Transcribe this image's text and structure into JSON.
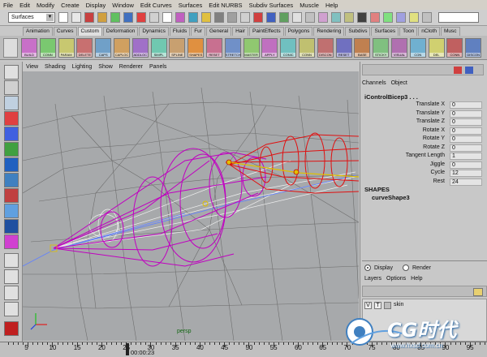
{
  "menubar": [
    "File",
    "Edit",
    "Modify",
    "Create",
    "Display",
    "Window",
    "Edit Curves",
    "Surfaces",
    "Edit NURBS",
    "Subdiv Surfaces",
    "Muscle",
    "Help"
  ],
  "mode_select": "Surfaces",
  "shelf_tabs": [
    "Animation",
    "Curves",
    "Custom",
    "Deformation",
    "Dynamics",
    "Fluids",
    "Fur",
    "General",
    "Hair",
    "PaintEffects",
    "Polygons",
    "Rendering",
    "Subdivs",
    "Surfaces",
    "Toon",
    "nCloth",
    "Musc"
  ],
  "active_shelf_tab": "Custom",
  "shelf_buttons": [
    {
      "label": "BUILD",
      "color": "#c870c8"
    },
    {
      "label": "CONN",
      "color": "#7ac870"
    },
    {
      "label": "PARAM",
      "color": "#c8c870"
    },
    {
      "label": "DELETE",
      "color": "#c87070"
    },
    {
      "label": "CAPS",
      "color": "#70a0c8"
    },
    {
      "label": "CAPLOC",
      "color": "#d0a060"
    },
    {
      "label": "ADDLOC",
      "color": "#a070c8"
    },
    {
      "label": "SIMPL",
      "color": "#70c8b0"
    },
    {
      "label": "SPLINE",
      "color": "#c8a070"
    },
    {
      "label": "SHAPES",
      "color": "#e09040"
    },
    {
      "label": "RESET",
      "color": "#c87090"
    },
    {
      "label": "STRETCH",
      "color": "#7090c8"
    },
    {
      "label": "MASTER",
      "color": "#90c870"
    },
    {
      "label": "APPLY",
      "color": "#c070c0"
    },
    {
      "label": "CONIC",
      "color": "#70c0c0"
    },
    {
      "label": "CONN",
      "color": "#c0c070"
    },
    {
      "label": "DISCON",
      "color": "#c07070"
    },
    {
      "label": "RESET",
      "color": "#7070c0"
    },
    {
      "label": "BASE",
      "color": "#c08050"
    },
    {
      "label": "STICKY",
      "color": "#80c080"
    },
    {
      "label": "VISUAL",
      "color": "#b070b0"
    },
    {
      "label": "CON",
      "color": "#70b0d0"
    },
    {
      "label": "DEL",
      "color": "#d0d070"
    },
    {
      "label": "CONN",
      "color": "#c06060"
    },
    {
      "label": "DISCON",
      "color": "#6080c0"
    }
  ],
  "viewport_menu": [
    "View",
    "Shading",
    "Lighting",
    "Show",
    "Renderer",
    "Panels"
  ],
  "viewport_label": "persp",
  "channel_box": {
    "menu": [
      "Channels",
      "Object"
    ],
    "object_name": "iControlBicep3 . . .",
    "attributes": [
      {
        "label": "Translate X",
        "value": "0"
      },
      {
        "label": "Translate Y",
        "value": "0"
      },
      {
        "label": "Translate Z",
        "value": "0"
      },
      {
        "label": "Rotate X",
        "value": "0"
      },
      {
        "label": "Rotate Y",
        "value": "0"
      },
      {
        "label": "Rotate Z",
        "value": "0"
      },
      {
        "label": "Tangent Length",
        "value": "1"
      },
      {
        "label": "Jiggle",
        "value": "0"
      },
      {
        "label": "Cycle",
        "value": "12"
      },
      {
        "label": "Rest",
        "value": "24"
      }
    ],
    "shapes_header": "SHAPES",
    "shape_name": "curveShape3"
  },
  "layer_editor": {
    "display_label": "Display",
    "render_label": "Render",
    "menu": [
      "Layers",
      "Options",
      "Help"
    ],
    "layer": {
      "v": "V",
      "t": "T",
      "name": "skin"
    }
  },
  "timeline": {
    "ticks": [
      5,
      10,
      15,
      20,
      25,
      30,
      35,
      40,
      45,
      50,
      55,
      60,
      65,
      70,
      75,
      80,
      85,
      90,
      95
    ],
    "current_time": "00:00:23"
  },
  "watermark": {
    "brand": "CG时代",
    "url": "www.hxsd.com.cn"
  },
  "colors": {
    "curve_magenta": "#c000c0",
    "curve_red": "#e01010",
    "wire_gray": "#6e6e6e",
    "accent_yellow": "#e0c000"
  }
}
